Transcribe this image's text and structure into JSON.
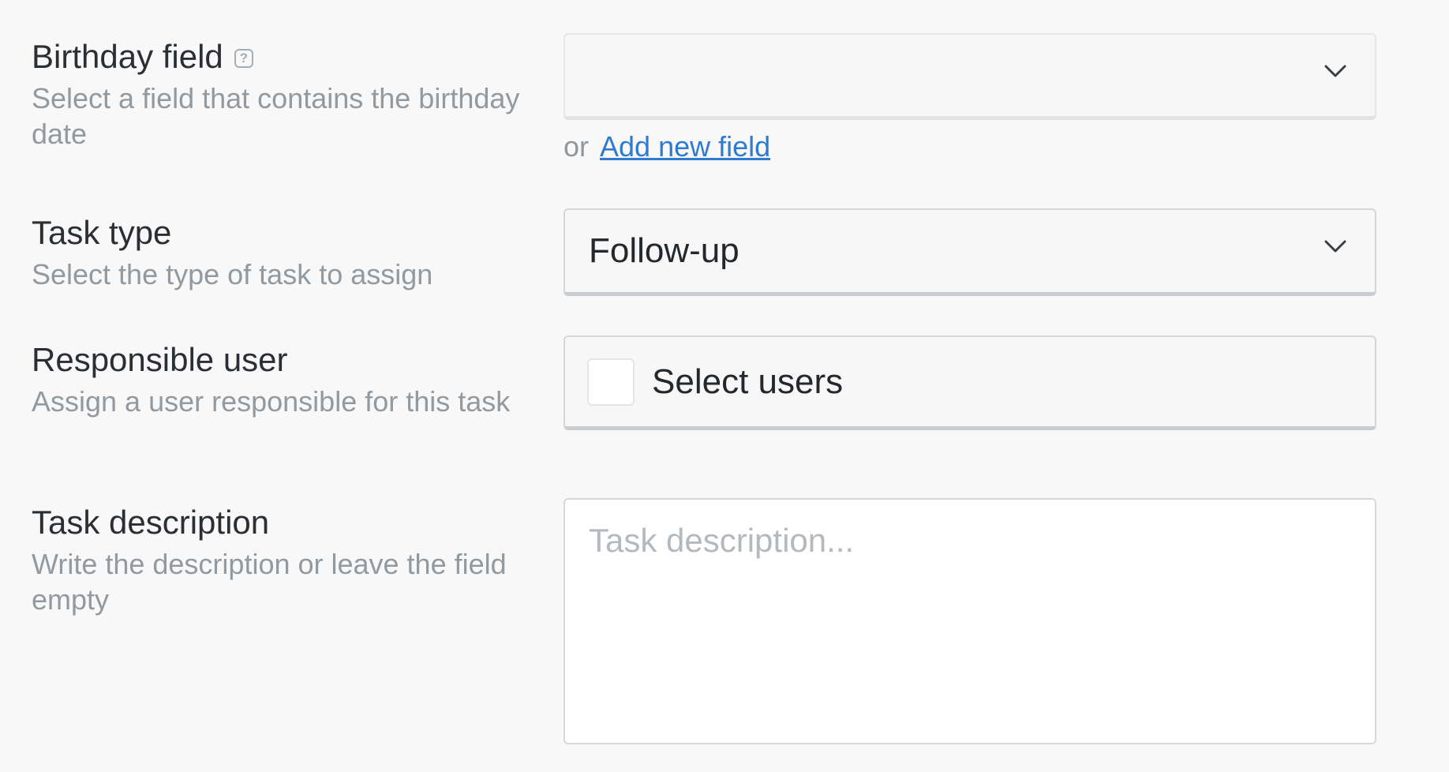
{
  "birthday": {
    "title": "Birthday field",
    "description": "Select a field that contains the birthday date",
    "selected": "",
    "or_text": "or",
    "add_link": "Add new field"
  },
  "task_type": {
    "title": "Task type",
    "description": "Select the type of task to assign",
    "selected": "Follow-up"
  },
  "responsible": {
    "title": "Responsible user",
    "description": "Assign a user responsible for this task",
    "select_label": "Select users"
  },
  "description": {
    "title": "Task description",
    "description": "Write the description or leave the field empty",
    "placeholder": "Task description..."
  },
  "icons": {
    "help": "help-icon",
    "chevron": "chevron-down-icon"
  },
  "colors": {
    "link": "#2f7bd0",
    "title": "#2b2f33",
    "description": "#92999f"
  }
}
